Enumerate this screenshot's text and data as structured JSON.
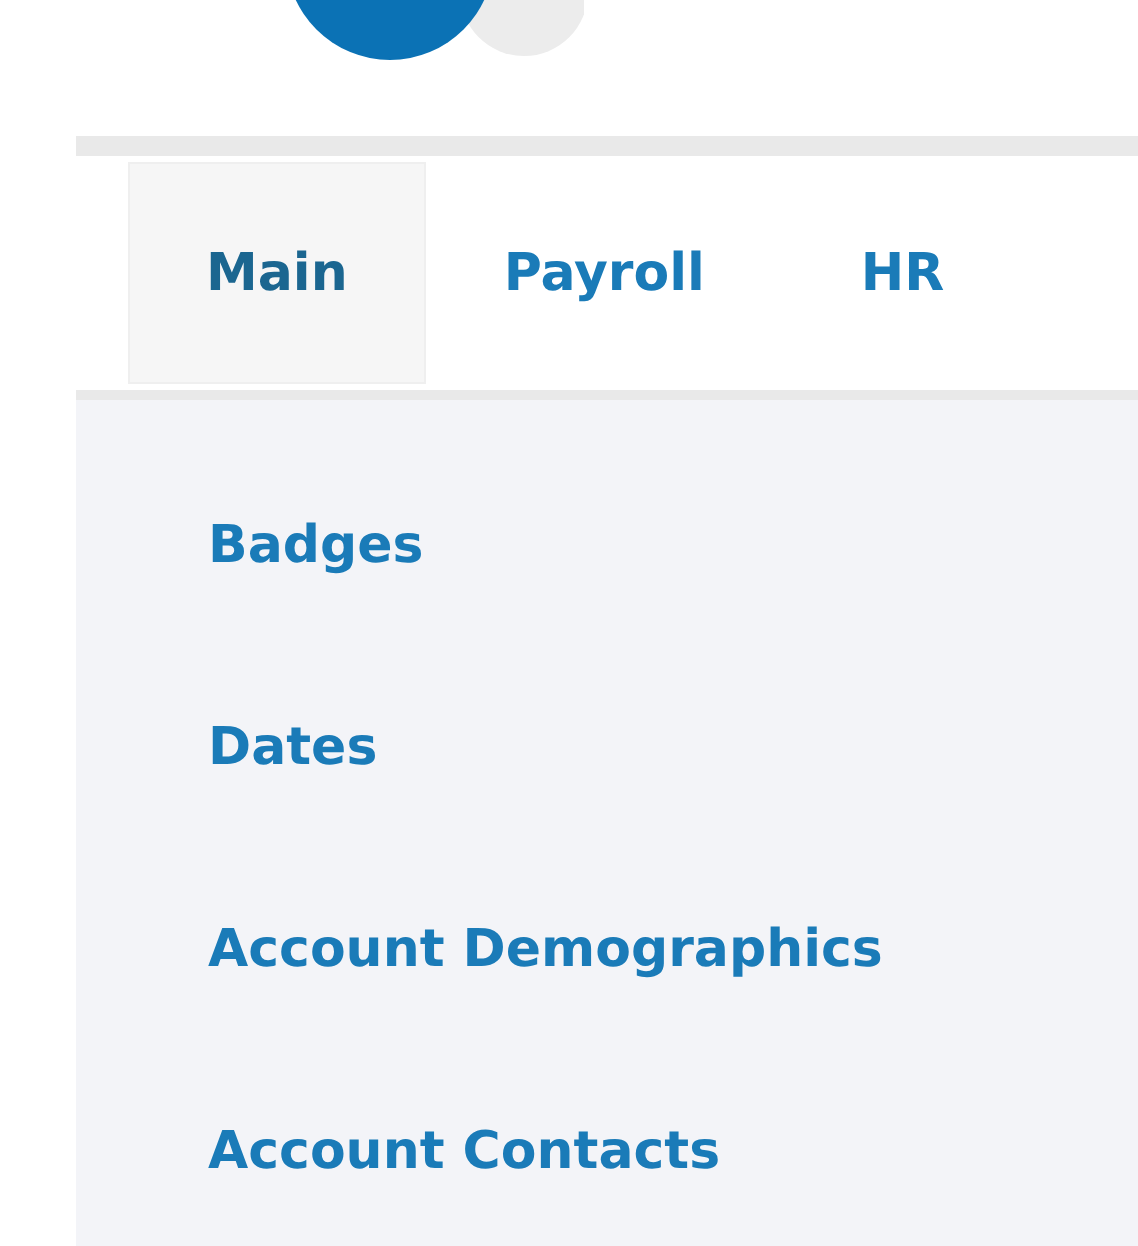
{
  "tabs": [
    {
      "label": "Main",
      "selected": true
    },
    {
      "label": "Payroll",
      "selected": false
    },
    {
      "label": "HR",
      "selected": false
    }
  ],
  "menu": {
    "items": [
      {
        "label": "Badges"
      },
      {
        "label": "Dates"
      },
      {
        "label": "Account Demographics"
      },
      {
        "label": "Account Contacts"
      }
    ]
  }
}
